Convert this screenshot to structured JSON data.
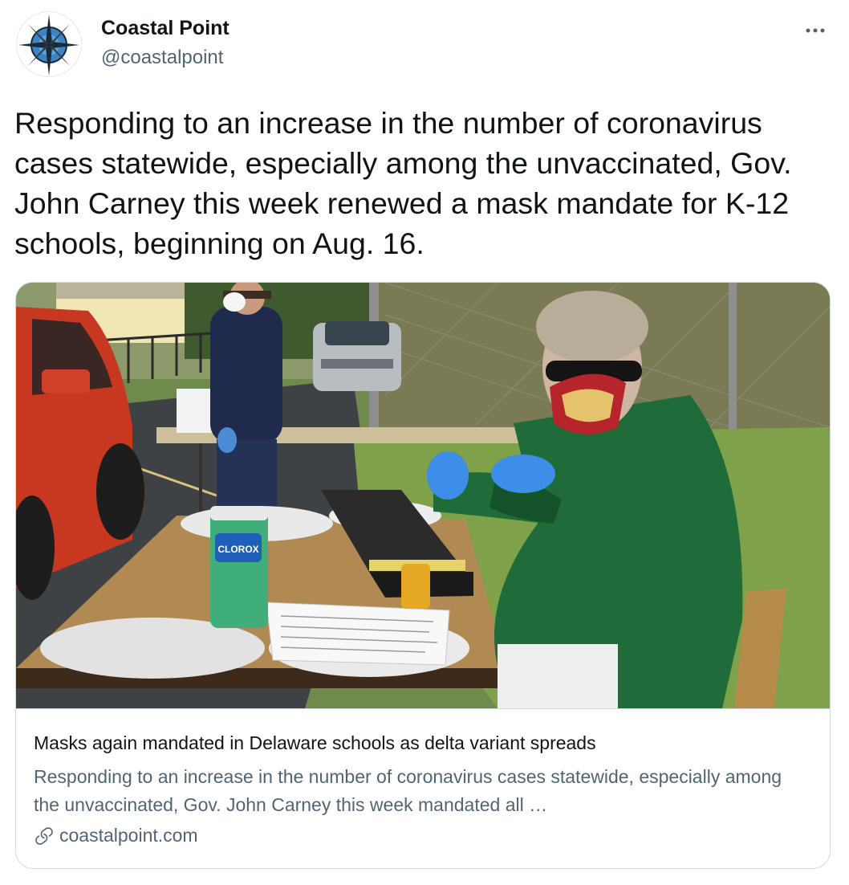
{
  "author": {
    "name": "Coastal Point",
    "handle": "@coastalpoint",
    "avatar_icon": "compass-logo"
  },
  "more_icon": "more-horizontal-icon",
  "tweet": {
    "text": "Responding to an increase in the number of coronavirus cases statewide, especially among the unvaccinated, Gov. John Carney this week renewed a mask mandate for K-12 schools, beginning on Aug. 16."
  },
  "card": {
    "title": "Masks again mandated in Delaware schools as delta variant spreads",
    "description": "Responding to an increase in the number of coronavirus cases statewide, especially among the unvaccinated, Gov. John Carney this week mandated all …",
    "domain": "coastalpoint.com",
    "link_icon": "link-icon",
    "wipes_label": "CLOROX"
  },
  "colors": {
    "text_primary": "#0f1419",
    "text_secondary": "#536471",
    "border": "#cfd9de"
  }
}
